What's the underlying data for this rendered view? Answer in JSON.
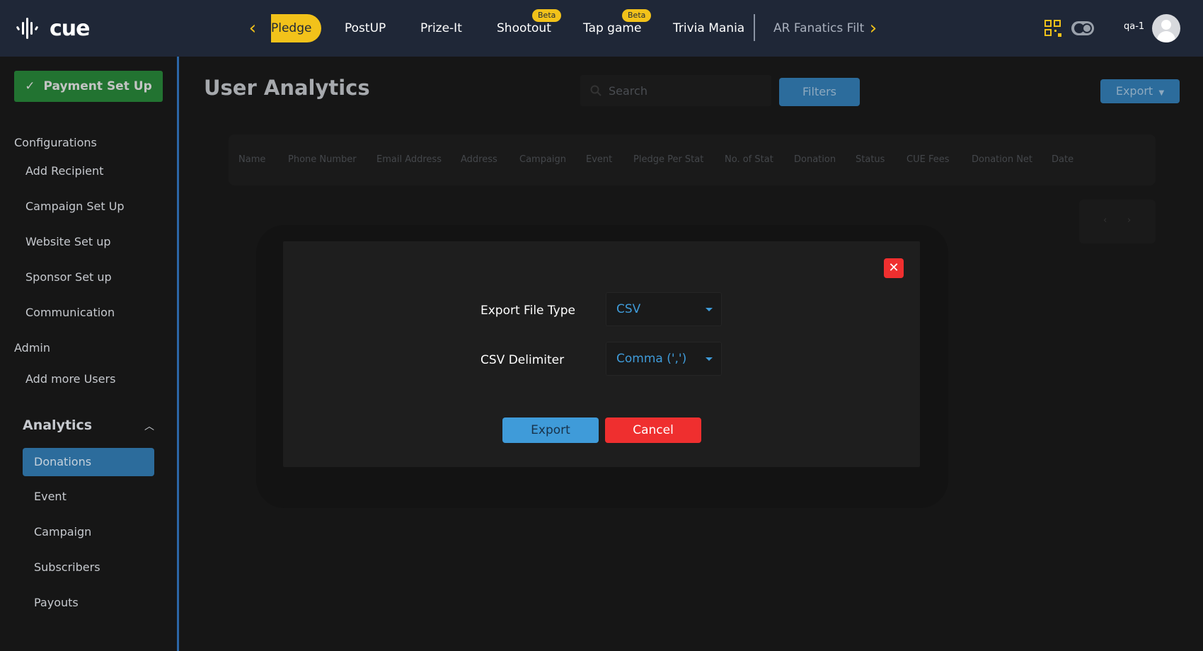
{
  "brand": {
    "logo_text": "cue"
  },
  "topnav": {
    "items": [
      {
        "label": "Pledge"
      },
      {
        "label": "PostUP"
      },
      {
        "label": "Prize-It"
      },
      {
        "label": "Shootout",
        "badge": "Beta"
      },
      {
        "label": "Tap game",
        "badge": "Beta"
      },
      {
        "label": "Trivia Mania"
      },
      {
        "label": "AR Fanatics Filt"
      }
    ],
    "prev_icon": "chevron-left-icon",
    "next_icon": "chevron-right-icon",
    "user_name": "qa-1"
  },
  "sidebar": {
    "payment_label": "Payment Set Up",
    "configurations_heading": "Configurations",
    "config_items": [
      "Add Recipient",
      "Campaign Set Up",
      "Website Set up",
      "Sponsor Set up",
      "Communication"
    ],
    "admin_heading": "Admin",
    "admin_items": [
      "Add more Users"
    ],
    "analytics_heading": "Analytics",
    "analytics_items": [
      "Donations",
      "Event",
      "Campaign",
      "Subscribers",
      "Payouts"
    ],
    "active_item": "Donations"
  },
  "main": {
    "title": "User Analytics",
    "search_placeholder": "Search",
    "filters_label": "Filters",
    "export_label": "Export",
    "columns": [
      "Name",
      "Phone Number",
      "Email Address",
      "Address",
      "Campaign",
      "Event",
      "Pledge Per Stat",
      "No. of Stat",
      "Donation",
      "Status",
      "CUE Fees",
      "Donation Net",
      "Date"
    ]
  },
  "modal": {
    "file_type_label": "Export File Type",
    "file_type_value": "CSV",
    "delimiter_label": "CSV Delimiter",
    "delimiter_value": "Comma (',')",
    "export_button": "Export",
    "cancel_button": "Cancel",
    "close_glyph": "✕"
  },
  "colors": {
    "topbar": "#1f2737",
    "accent_yellow": "#f2c21a",
    "primary_blue": "#3f9bd9",
    "danger_red": "#ef2f2f",
    "success_green": "#27933a"
  }
}
